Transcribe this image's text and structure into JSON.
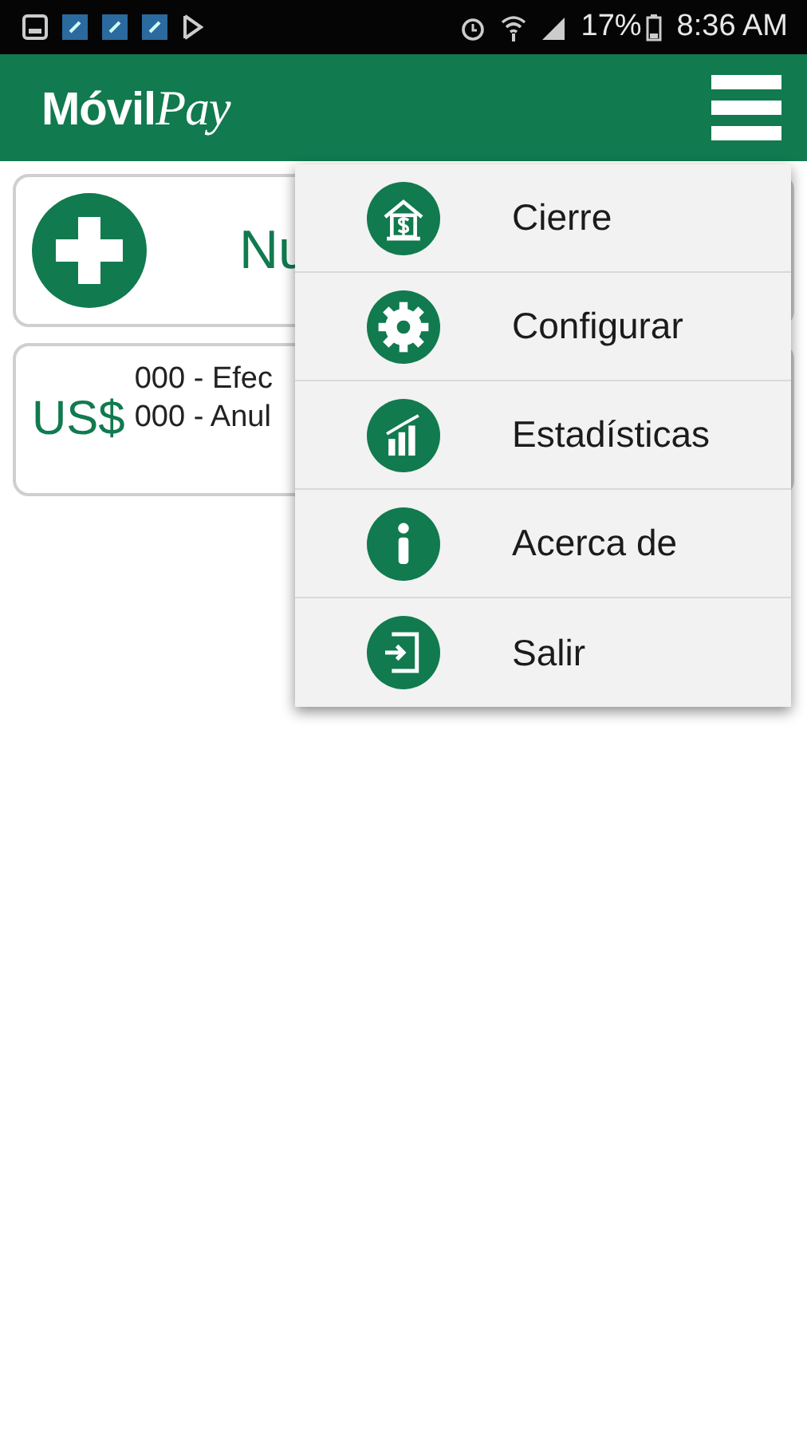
{
  "status_bar": {
    "battery": "17%",
    "time": "8:36 AM"
  },
  "app_bar": {
    "logo": {
      "bold": "Móvil",
      "script": "Pay"
    }
  },
  "cards": [
    {
      "kind": "new",
      "label": "Nu"
    },
    {
      "kind": "summary",
      "currency": "US$",
      "lines": [
        "000 - Efec",
        "000 - Anul"
      ]
    }
  ],
  "menu": {
    "open": true,
    "items": [
      {
        "kind": "closing",
        "label": "Cierre"
      },
      {
        "kind": "settings",
        "label": "Configurar"
      },
      {
        "kind": "stats",
        "label": "Estadísticas"
      },
      {
        "kind": "info",
        "label": "Acerca de"
      },
      {
        "kind": "exit",
        "label": "Salir"
      }
    ]
  }
}
